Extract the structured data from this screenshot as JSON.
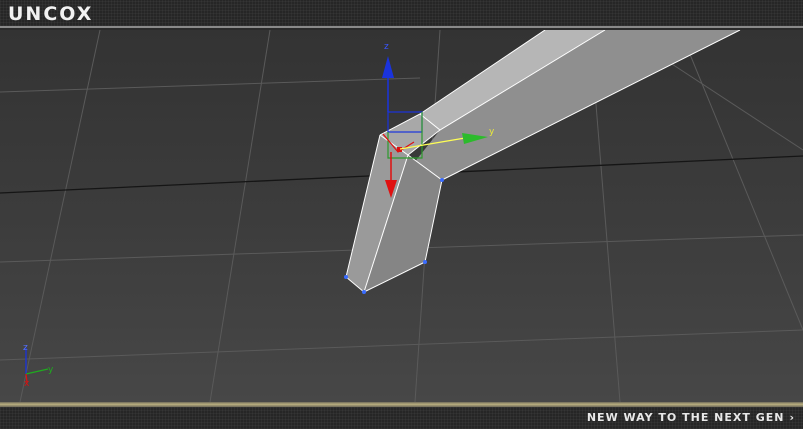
{
  "header": {
    "logo_text": "UNCOX"
  },
  "viewport": {
    "gizmo": {
      "z_label": "z",
      "y_label": "y"
    },
    "corner_axes": {
      "z_label": "z",
      "y_label": "y",
      "x_label": "x"
    }
  },
  "footer": {
    "tagline": "NEW WAY TO THE NEXT GEN",
    "chevron": "›"
  },
  "colors": {
    "x_axis": "#e01010",
    "y_axis": "#1faa1f",
    "z_axis": "#1a33dd",
    "selection": "#ffff55",
    "wire": "#ffffff",
    "vertex": "#3a6cff"
  }
}
